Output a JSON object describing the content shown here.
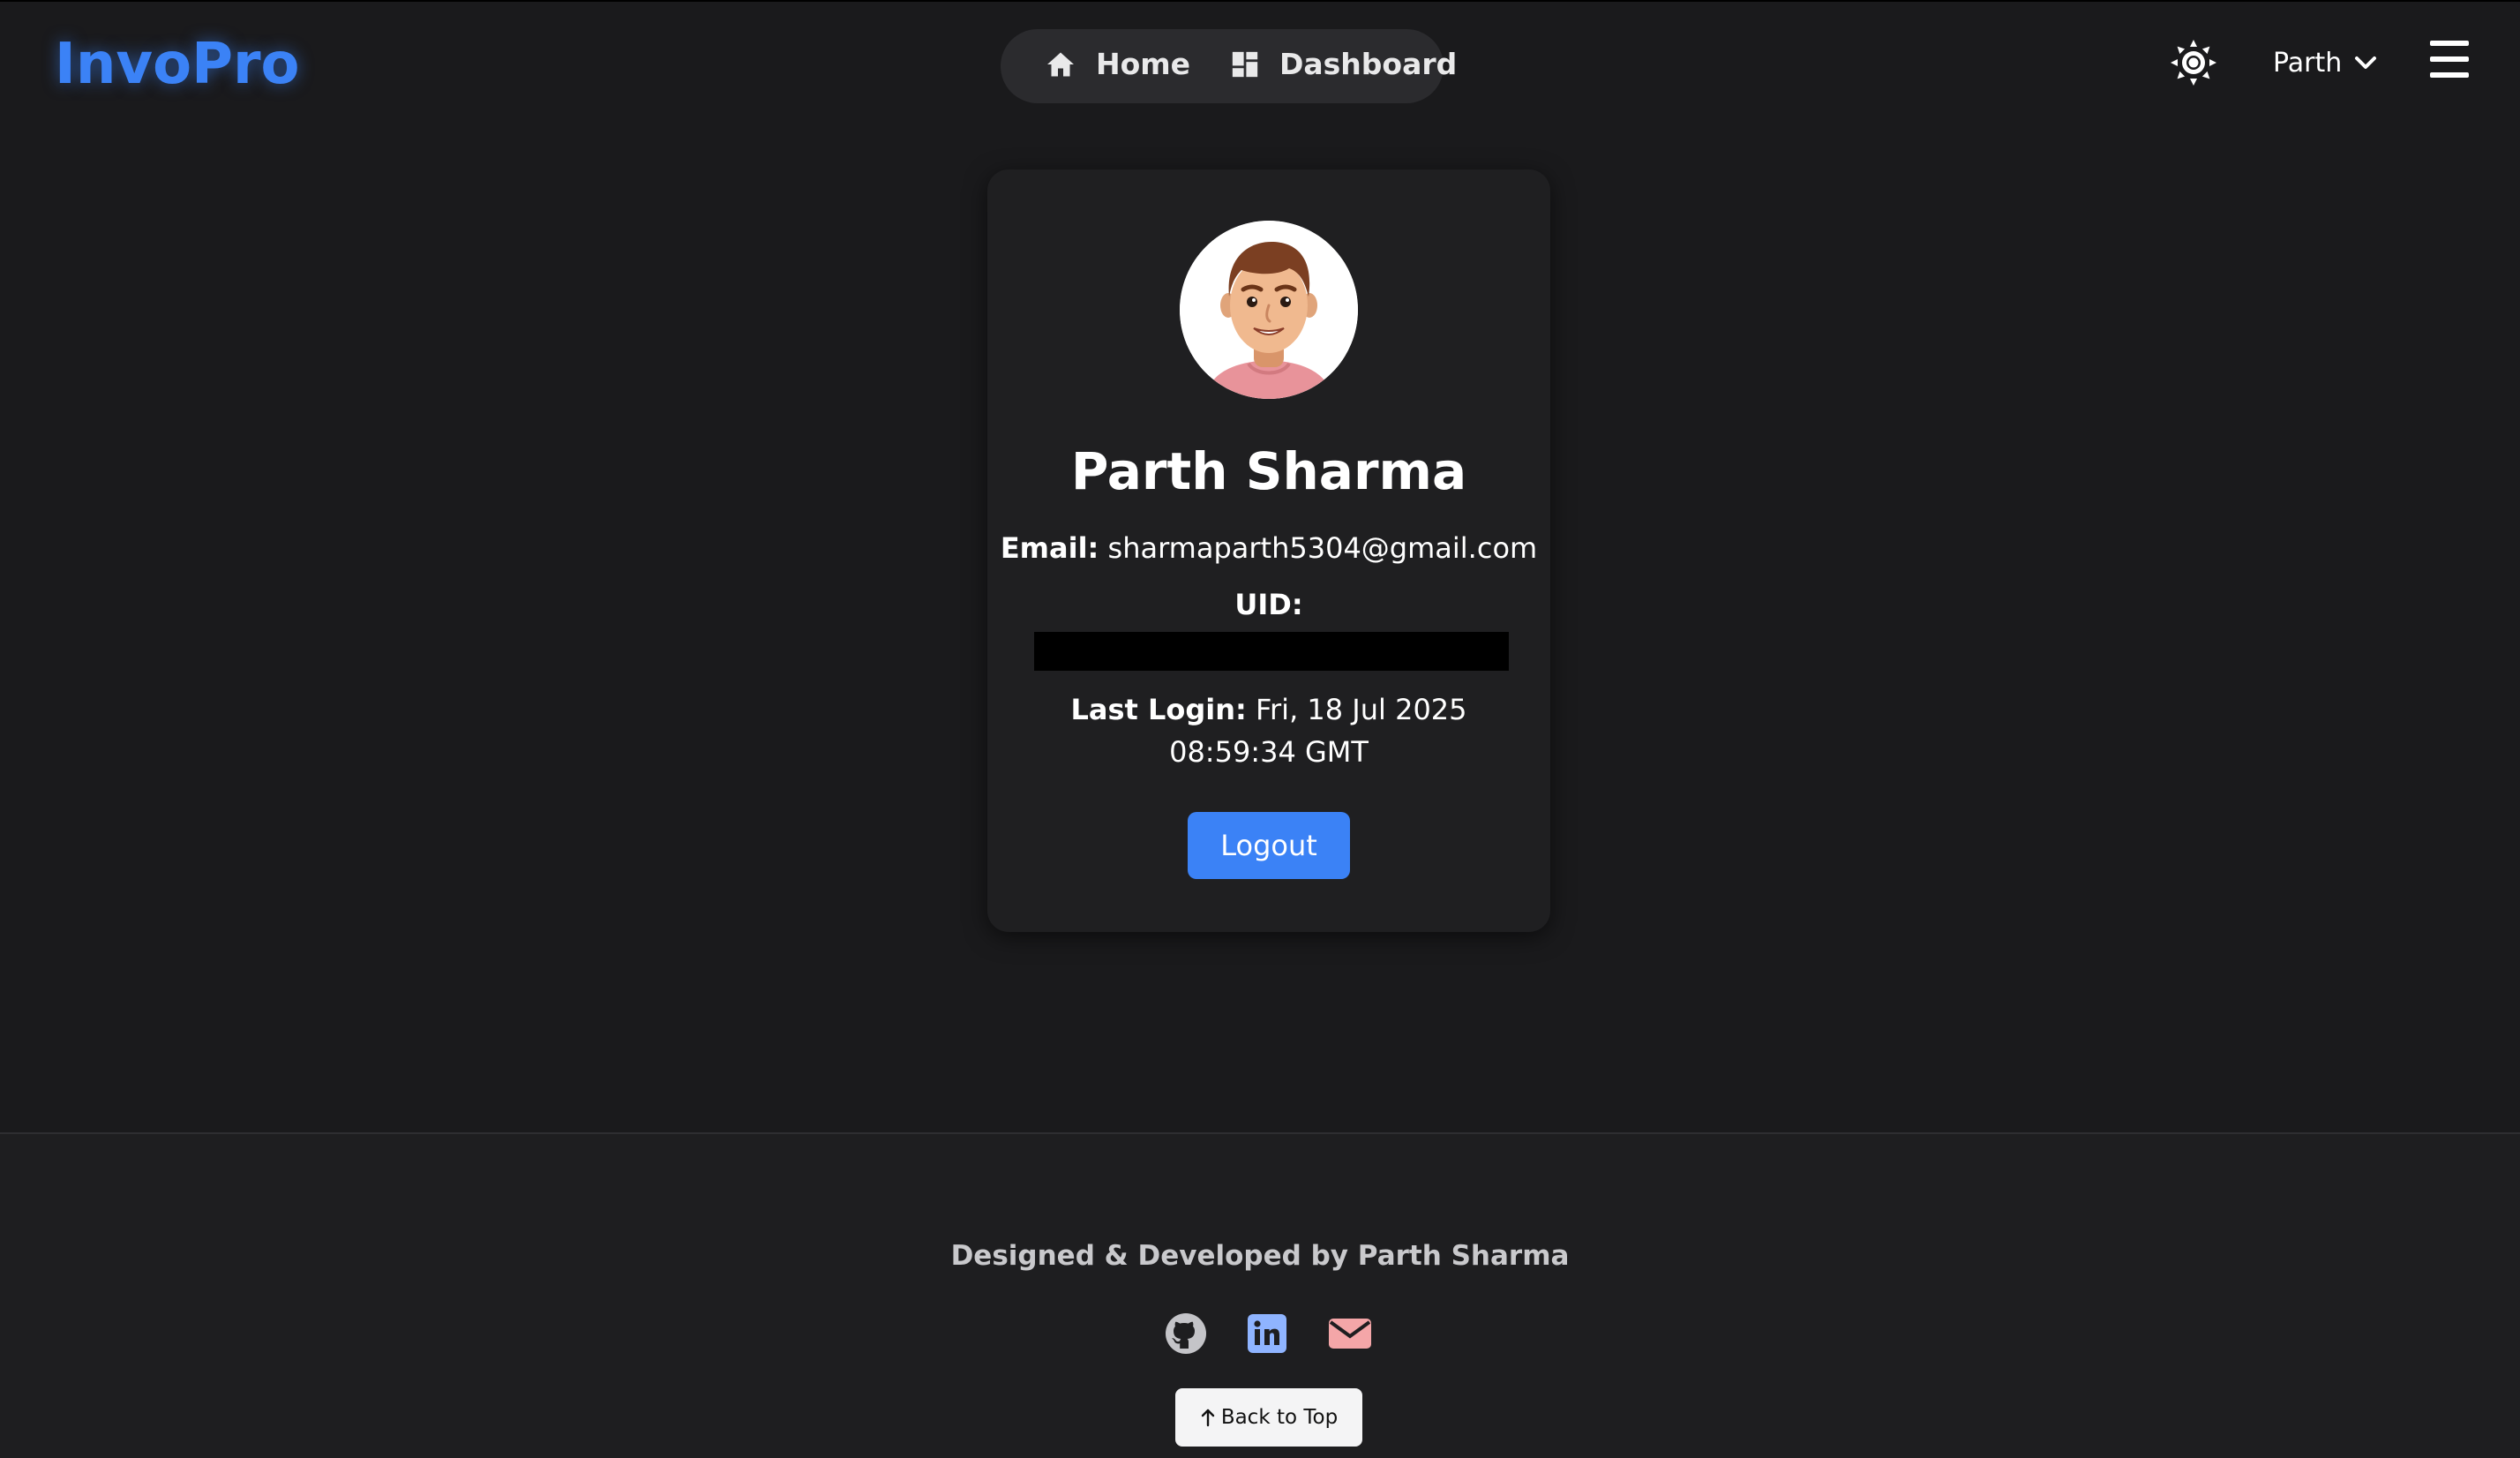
{
  "header": {
    "logo": "InvoPro",
    "nav": [
      {
        "label": "Home",
        "icon": "home-icon"
      },
      {
        "label": "Dashboard",
        "icon": "dashboard-icon"
      }
    ],
    "theme_toggle_icon": "sun-icon",
    "user_menu_label": "Parth",
    "menu_icon": "hamburger-icon"
  },
  "profile": {
    "name": "Parth Sharma",
    "email_label": "Email:",
    "email": "sharmaparth5304@gmail.com",
    "uid_label": "UID:",
    "uid_value_redacted": true,
    "last_login_label": "Last Login:",
    "last_login_line1": "Fri, 18 Jul 2025",
    "last_login_line2": "08:59:34 GMT",
    "logout_label": "Logout"
  },
  "footer": {
    "credit": "Designed & Developed by Parth Sharma",
    "social": [
      {
        "icon": "github-icon"
      },
      {
        "icon": "linkedin-icon"
      },
      {
        "icon": "email-icon"
      }
    ],
    "back_to_top_label": "Back to Top"
  },
  "colors": {
    "background": "#1a1a1c",
    "accent": "#3b82f6",
    "card": "#1f1f21",
    "linkedin": "#8fb4ff",
    "email_icon": "#f4a6a8"
  }
}
